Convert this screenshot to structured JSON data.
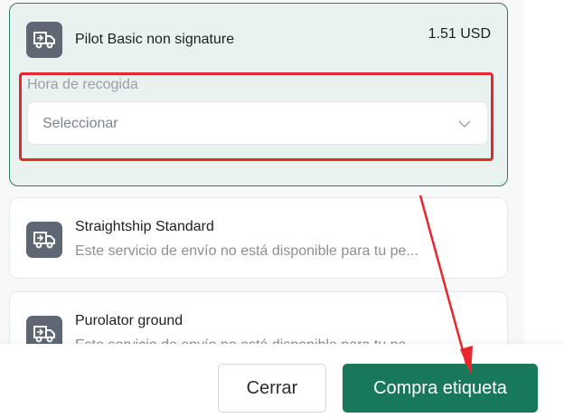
{
  "carriers": [
    {
      "name": "Pilot Basic non signature",
      "price": "1.51 USD",
      "pickup_label": "Hora de recogida",
      "pickup_placeholder": "Seleccionar"
    },
    {
      "name": "Straightship Standard",
      "subtitle": "Este servicio de envío no está disponible para tu pe..."
    },
    {
      "name": "Purolator ground",
      "subtitle": "Este servicio de envío no está disponible para tu pe..."
    }
  ],
  "footer": {
    "close_label": "Cerrar",
    "buy_label": "Compra etiqueta"
  },
  "icons": {
    "carrier": "delivery-truck-icon",
    "select_chevron": "chevron-down-icon"
  },
  "colors": {
    "selected_bg": "#e8f3ef",
    "selected_border": "#2f7d63",
    "primary_button": "#18785c",
    "annotation_red": "#e8262b",
    "icon_box": "#5e6773"
  }
}
